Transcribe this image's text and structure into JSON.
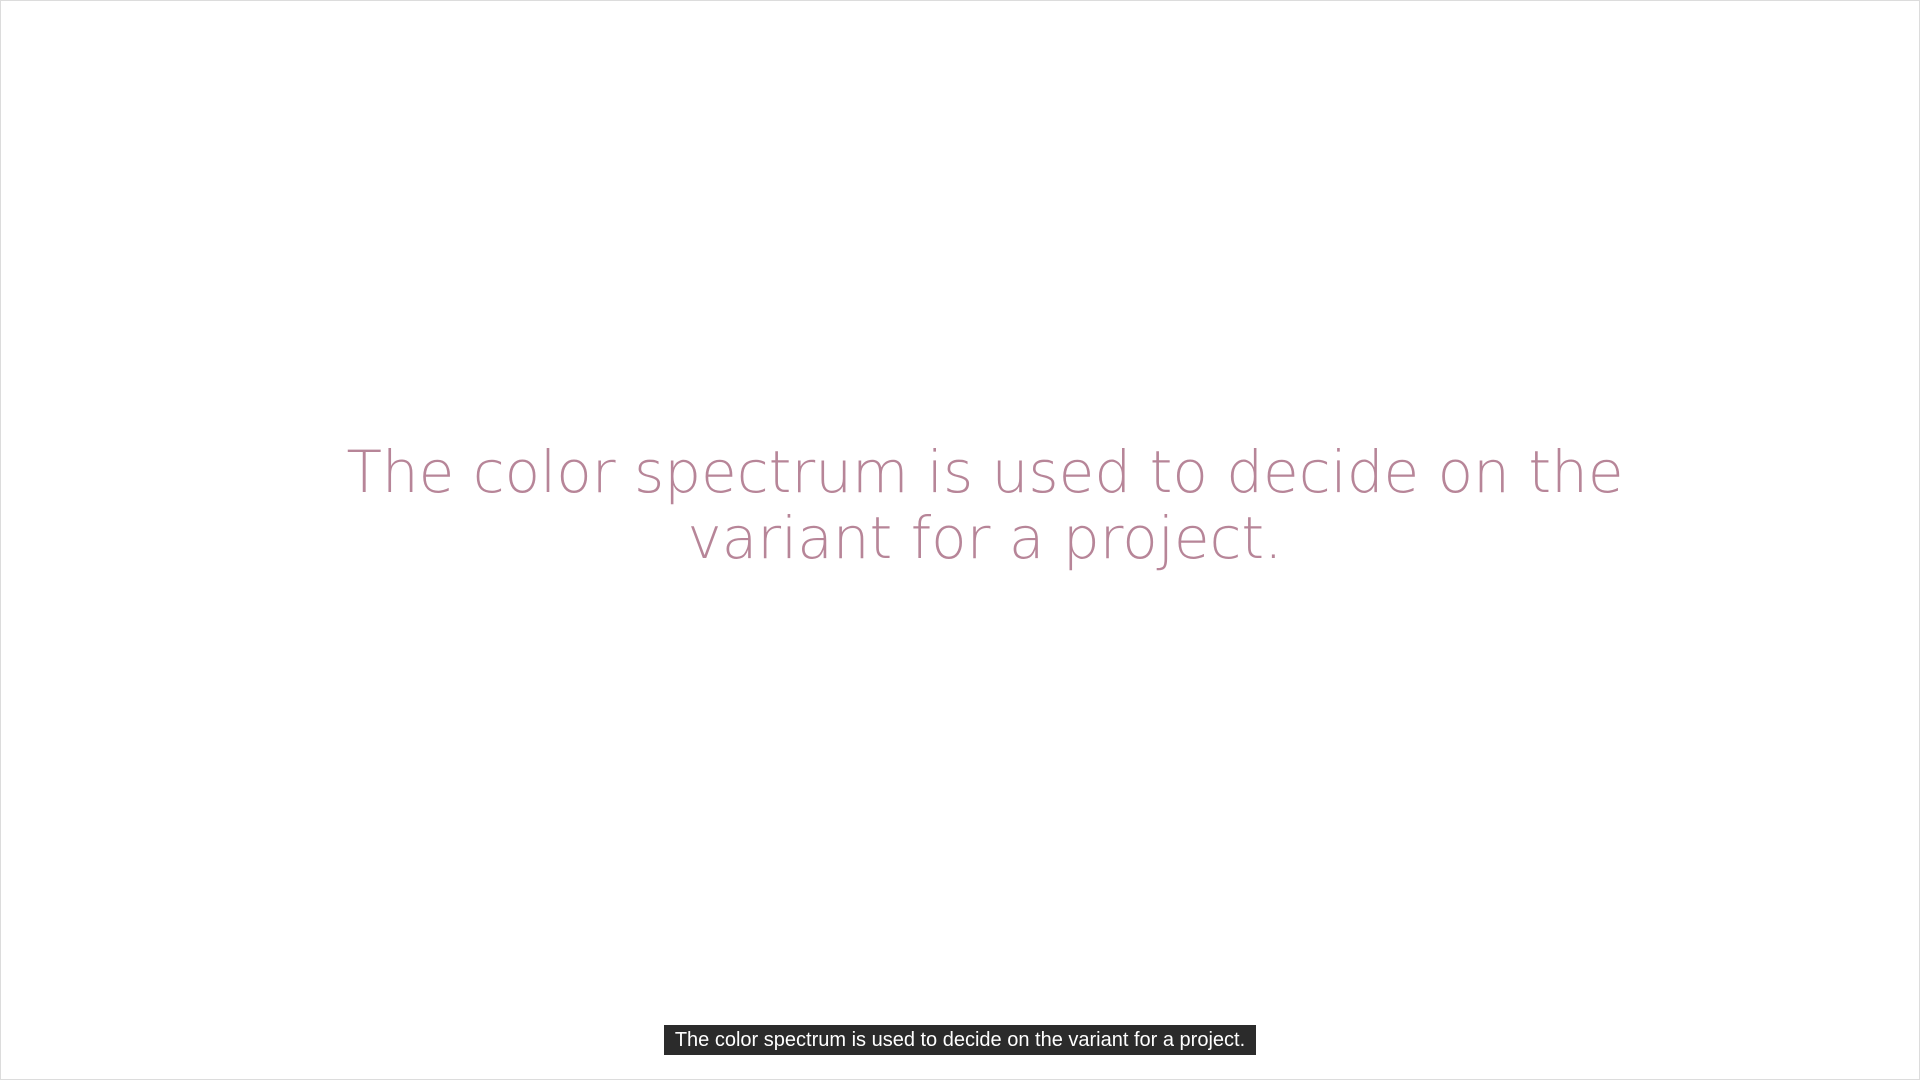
{
  "slide": {
    "text": "The color spectrum is used to decide on the variant for a project.",
    "text_color": "#b78598"
  },
  "caption": {
    "text": "The color spectrum is used to decide on the variant for a project.",
    "background_color": "#2b2b2b",
    "text_color": "#ffffff"
  }
}
